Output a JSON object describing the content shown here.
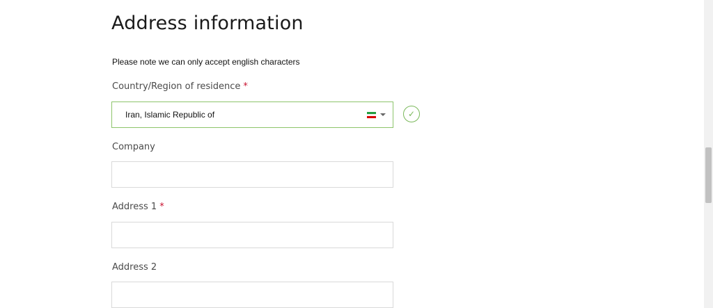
{
  "form": {
    "title": "Address information",
    "note": "Please note we can only accept english characters",
    "country": {
      "label": "Country/Region of residence",
      "required_mark": "*",
      "value": "Iran, Islamic Republic of",
      "flag_icon": "iran-flag-icon",
      "flag_colors": [
        "#239f40",
        "#ffffff",
        "#da0000"
      ],
      "valid_icon": "check-circle-icon",
      "check_glyph": "✓"
    },
    "company": {
      "label": "Company",
      "value": ""
    },
    "address1": {
      "label": "Address 1",
      "required_mark": "*",
      "value": ""
    },
    "address2": {
      "label": "Address 2",
      "value": ""
    }
  },
  "colors": {
    "valid_border": "#8cc46a",
    "required": "#c8102e"
  }
}
